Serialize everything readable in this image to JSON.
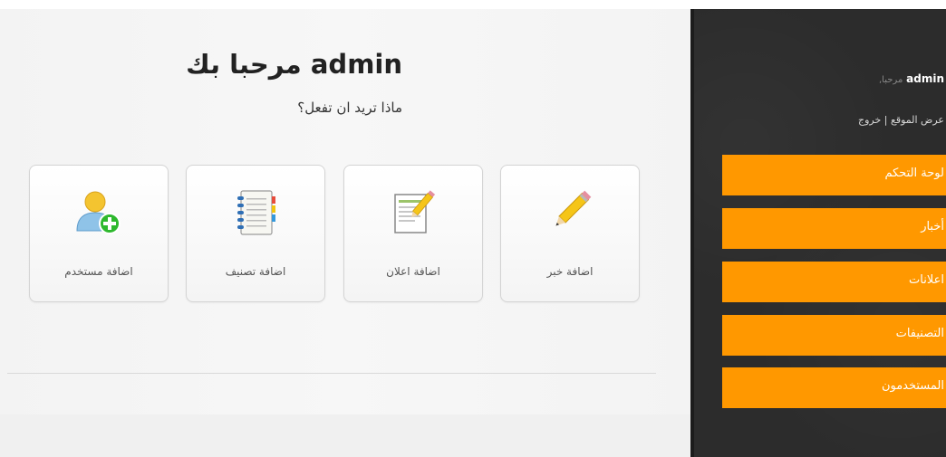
{
  "main": {
    "welcome": "admin مرحبا بك",
    "subtitle": "ماذا تريد ان تفعل؟",
    "cards": [
      {
        "label": "اضافة خبر",
        "icon": "pencil-icon"
      },
      {
        "label": "اضافة اعلان",
        "icon": "edit-document-icon"
      },
      {
        "label": "اضافة تصنيف",
        "icon": "notebook-icon"
      },
      {
        "label": "اضافة مستخدم",
        "icon": "add-user-icon"
      }
    ]
  },
  "sidebar": {
    "greeting": "مرحبا,",
    "username": "admin",
    "view_site": "عرض الموقع",
    "separator": "|",
    "logout": "خروج",
    "nav": [
      {
        "label": "لوحة التحكم"
      },
      {
        "label": "أخبار"
      },
      {
        "label": "اعلانات"
      },
      {
        "label": "التصنيفات"
      },
      {
        "label": "المستخدمون"
      }
    ]
  },
  "colors": {
    "accent": "#ff9800",
    "sidebar_bg": "#2c2c2c",
    "main_bg": "#f5f5f5"
  }
}
